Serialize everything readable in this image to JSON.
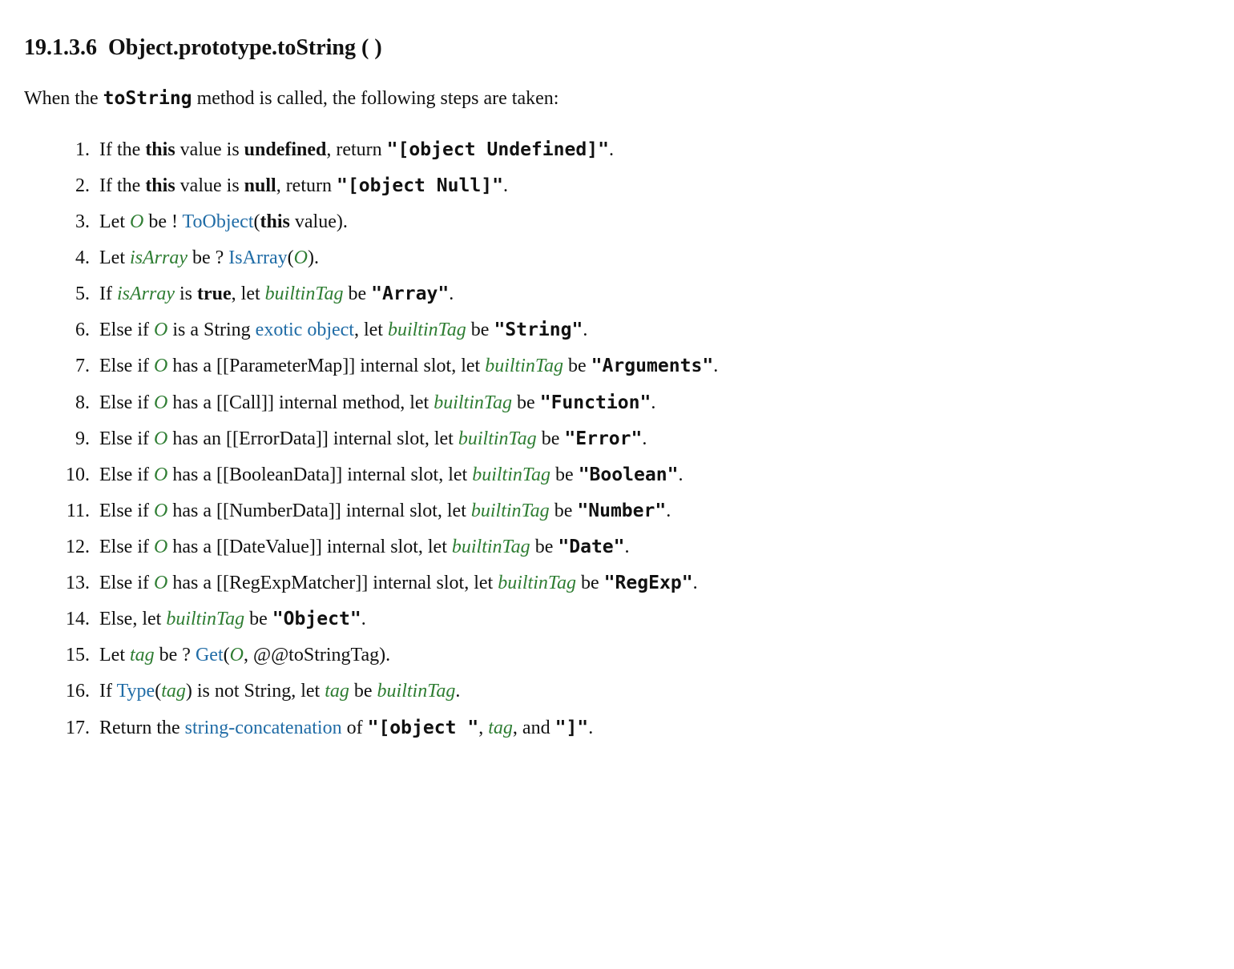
{
  "heading": {
    "number": "19.1.3.6",
    "title": "Object.prototype.toString ( )"
  },
  "intro": {
    "t1": "When the ",
    "method": "toString",
    "t2": " method is called, the following steps are taken:"
  },
  "s1": {
    "a": "If the ",
    "this": "this",
    "b": " value is ",
    "undef": "undefined",
    "c": ", return ",
    "ret": "\"[object Undefined]\"",
    "d": "."
  },
  "s2": {
    "a": "If the ",
    "this": "this",
    "b": " value is ",
    "null": "null",
    "c": ", return ",
    "ret": "\"[object Null]\"",
    "d": "."
  },
  "s3": {
    "a": "Let ",
    "O": "O",
    "b": " be ! ",
    "toobject": "ToObject",
    "c": "(",
    "this": "this",
    "d": " value)."
  },
  "s4": {
    "a": "Let ",
    "isArray": "isArray",
    "b": " be ? ",
    "isArrayFn": "IsArray",
    "c": "(",
    "O": "O",
    "d": ")."
  },
  "s5": {
    "a": "If ",
    "isArray": "isArray",
    "b": " is ",
    "true": "true",
    "c": ", let ",
    "bt": "builtinTag",
    "d": " be ",
    "val": "\"Array\"",
    "e": "."
  },
  "s6": {
    "a": "Else if ",
    "O": "O",
    "b": " is a String ",
    "exotic": "exotic object",
    "c": ", let ",
    "bt": "builtinTag",
    "d": " be ",
    "val": "\"String\"",
    "e": "."
  },
  "s7": {
    "a": "Else if ",
    "O": "O",
    "b": " has a [[ParameterMap]] internal slot, let ",
    "bt": "builtinTag",
    "c": " be ",
    "val": "\"Arguments\"",
    "d": "."
  },
  "s8": {
    "a": "Else if ",
    "O": "O",
    "b": " has a [[Call]] internal method, let ",
    "bt": "builtinTag",
    "c": " be ",
    "val": "\"Function\"",
    "d": "."
  },
  "s9": {
    "a": "Else if ",
    "O": "O",
    "b": " has an [[ErrorData]] internal slot, let ",
    "bt": "builtinTag",
    "c": " be ",
    "val": "\"Error\"",
    "d": "."
  },
  "s10": {
    "a": "Else if ",
    "O": "O",
    "b": " has a [[BooleanData]] internal slot, let ",
    "bt": "builtinTag",
    "c": " be ",
    "val": "\"Boolean\"",
    "d": "."
  },
  "s11": {
    "a": "Else if ",
    "O": "O",
    "b": " has a [[NumberData]] internal slot, let ",
    "bt": "builtinTag",
    "c": " be ",
    "val": "\"Number\"",
    "d": "."
  },
  "s12": {
    "a": "Else if ",
    "O": "O",
    "b": " has a [[DateValue]] internal slot, let ",
    "bt": "builtinTag",
    "c": " be ",
    "val": "\"Date\"",
    "d": "."
  },
  "s13": {
    "a": "Else if ",
    "O": "O",
    "b": " has a [[RegExpMatcher]] internal slot, let ",
    "bt": "builtinTag",
    "c": " be ",
    "val": "\"RegExp\"",
    "d": "."
  },
  "s14": {
    "a": "Else, let ",
    "bt": "builtinTag",
    "b": " be ",
    "val": "\"Object\"",
    "c": "."
  },
  "s15": {
    "a": "Let ",
    "tag": "tag",
    "b": " be ? ",
    "get": "Get",
    "c": "(",
    "O": "O",
    "d": ", @@toStringTag)."
  },
  "s16": {
    "a": "If ",
    "type": "Type",
    "b": "(",
    "tag": "tag",
    "c": ") is not String, let ",
    "tag2": "tag",
    "d": " be ",
    "bt": "builtinTag",
    "e": "."
  },
  "s17": {
    "a": "Return the ",
    "concat": "string-concatenation",
    "b": " of ",
    "v1": "\"[object \"",
    "c": ", ",
    "tag": "tag",
    "d": ", and ",
    "v2": "\"]\"",
    "e": "."
  }
}
